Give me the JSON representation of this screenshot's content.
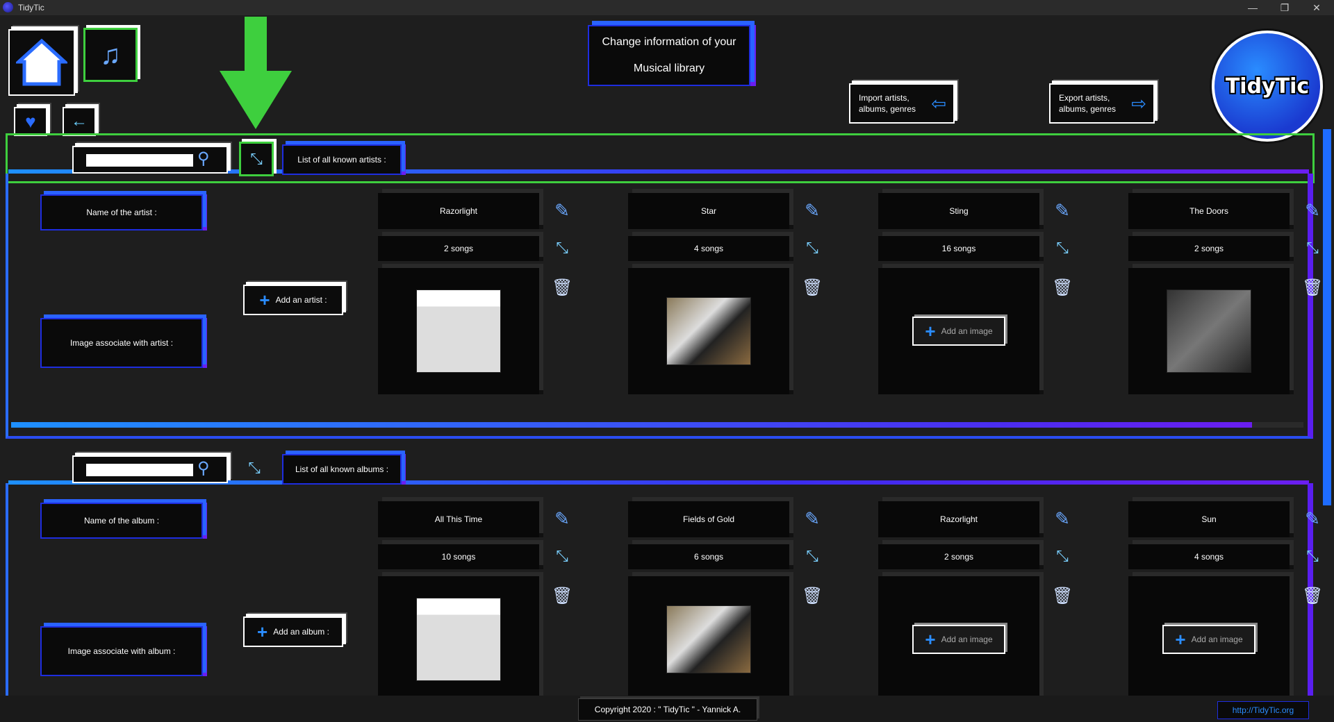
{
  "app": {
    "title": "TidyTic"
  },
  "header": {
    "change_info_line1": "Change information of your",
    "change_info_line2": "Musical library",
    "import_label_1": "Import artists,",
    "import_label_2": "albums, genres",
    "export_label_1": "Export artists,",
    "export_label_2": "albums, genres",
    "logo_text": "TidyTic"
  },
  "artists": {
    "list_label": "List of all known artists :",
    "name_label": "Name of the artist :",
    "image_label": "Image associate with artist :",
    "add_label": "Add an artist :",
    "items": [
      {
        "name": "Razorlight",
        "songs": "2 songs",
        "image": "razorlight",
        "has_image": true
      },
      {
        "name": "Star",
        "songs": "4 songs",
        "image": "dog",
        "has_image": true
      },
      {
        "name": "Sting",
        "songs": "16 songs",
        "image": "",
        "has_image": false
      },
      {
        "name": "The Doors",
        "songs": "2 songs",
        "image": "doors",
        "has_image": true
      }
    ],
    "scroll_fraction": 0.96
  },
  "albums": {
    "list_label": "List of all known albums :",
    "name_label": "Name of the album :",
    "image_label": "Image associate with album :",
    "add_label": "Add an album :",
    "items": [
      {
        "name": "All This Time",
        "songs": "10 songs",
        "has_image": true
      },
      {
        "name": "Fields of Gold",
        "songs": "6 songs",
        "has_image": true
      },
      {
        "name": "Razorlight",
        "songs": "2 songs",
        "has_image": false
      },
      {
        "name": "Sun",
        "songs": "4 songs",
        "has_image": false
      }
    ]
  },
  "add_image_label": "Add an image",
  "footer": {
    "copyright": "Copyright 2020 : \" TidyTic \" - Yannick A.",
    "link": "http://TidyTic.org"
  },
  "colors": {
    "accent_blue": "#2a6cff",
    "accent_purple": "#6a1ef0",
    "highlight_green": "#3ecf3e"
  }
}
